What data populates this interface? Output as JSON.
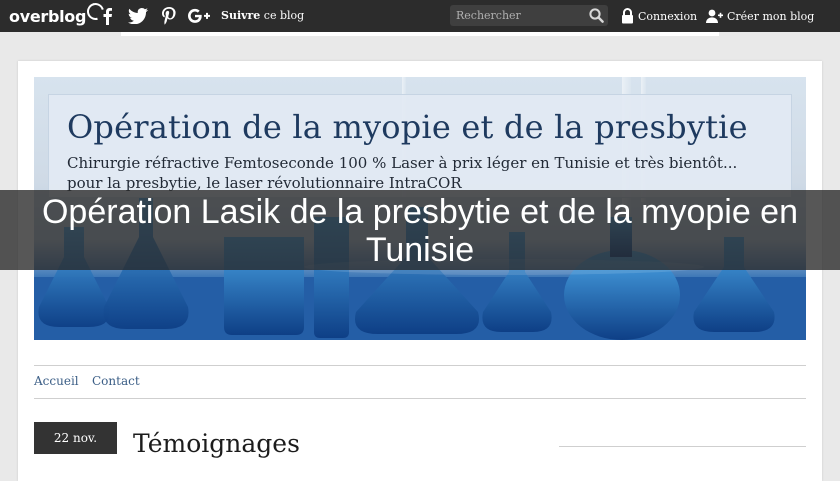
{
  "topbar": {
    "logo_text": "overblog",
    "social_icons": [
      "facebook-icon",
      "twitter-icon",
      "pinterest-icon",
      "google-plus-icon"
    ],
    "follow_bold": "Suivre",
    "follow_rest": " ce blog",
    "search_placeholder": "Rechercher",
    "login_label": "Connexion",
    "create_label": "Créer mon blog"
  },
  "banner": {
    "title": "Opération de la myopie et de la presbytie",
    "subtitle_line1": "Chirurgie réfractive Femtoseconde 100 % Laser à prix léger en Tunisie et très bientôt...",
    "subtitle_line2": "pour la presbytie, le laser révolutionnaire IntraCOR"
  },
  "overlay": {
    "title": "Opération Lasik de la presbytie et de la myopie en Tunisie"
  },
  "nav": {
    "items": [
      "Accueil",
      "Contact"
    ]
  },
  "post": {
    "date": "22 nov.",
    "title": "Témoignages"
  },
  "colors": {
    "topbar": "#2c2c2c",
    "link": "#3b5e86",
    "banner_blue": "#1d4f93"
  }
}
